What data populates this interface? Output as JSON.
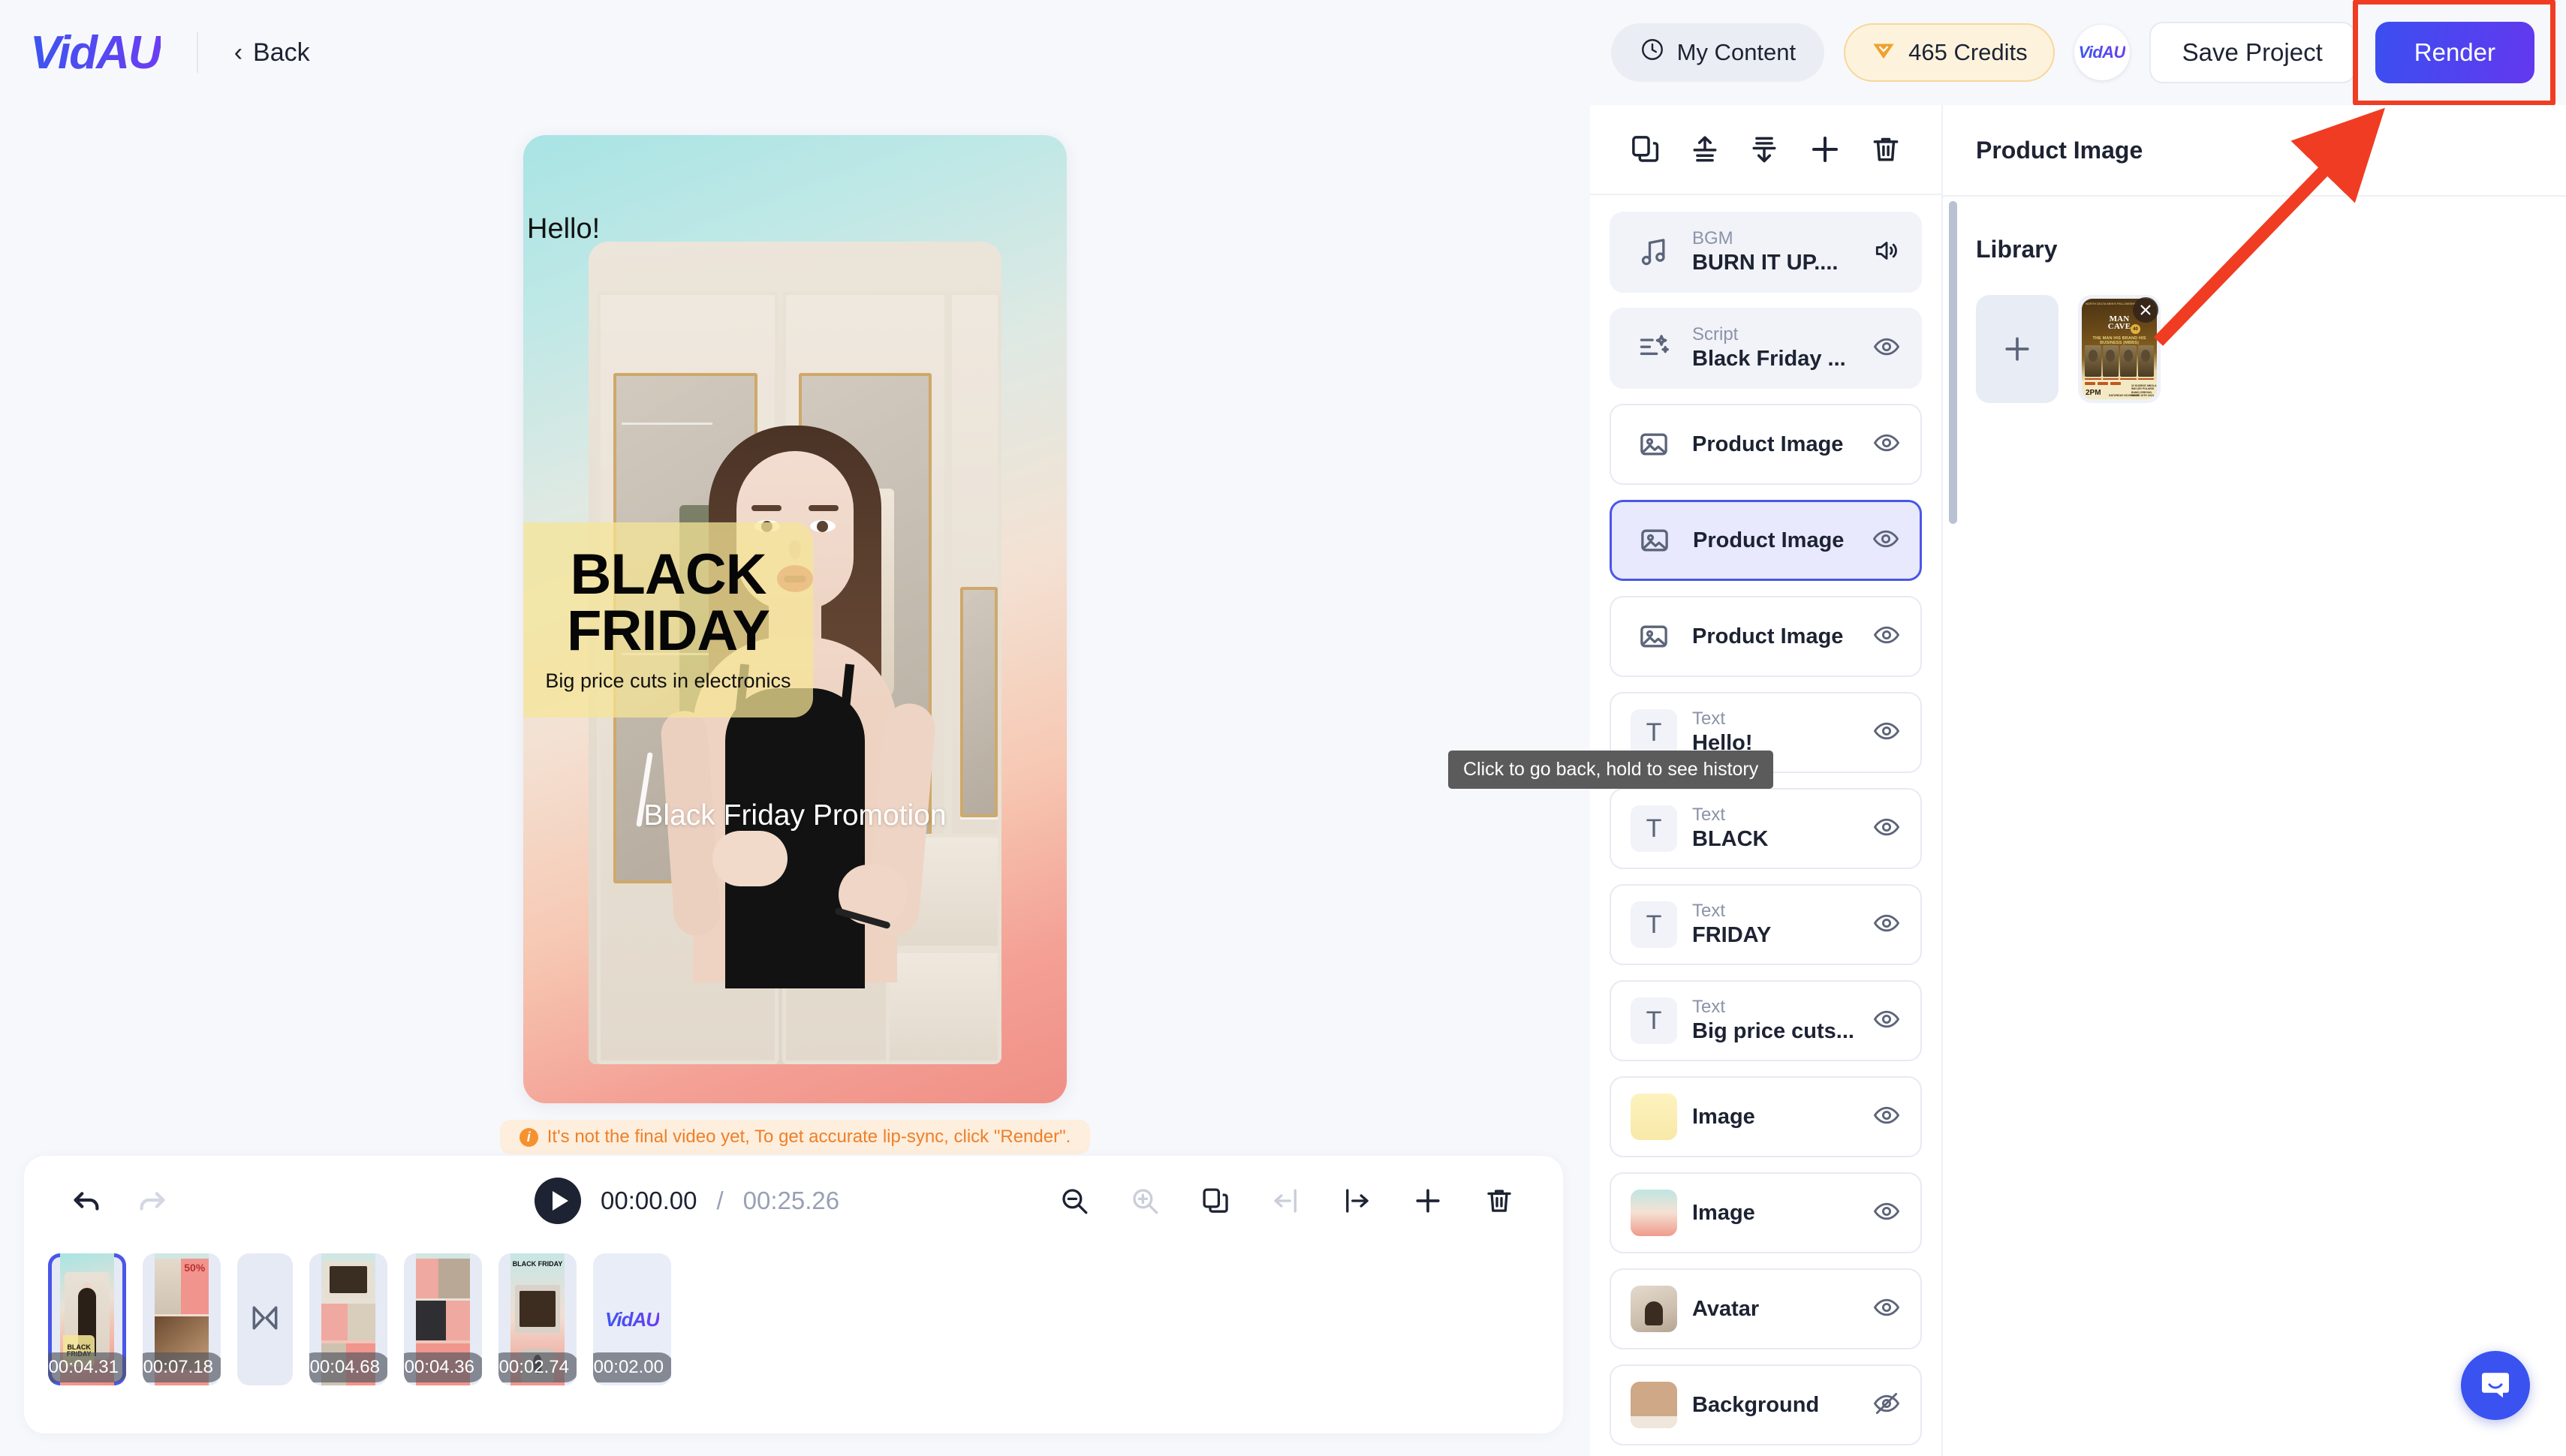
{
  "brand": {
    "logo": "VidAU",
    "accent": "#4a56e8",
    "render_gradient_from": "#3b4ff0",
    "render_gradient_to": "#6338ee"
  },
  "topbar": {
    "back_label": "Back",
    "my_content_label": "My Content",
    "credits_label": "465 Credits",
    "avatar_label": "VidAU",
    "save_label": "Save Project",
    "render_label": "Render"
  },
  "preview": {
    "hello_text": "Hello!",
    "black_text": "BLACK",
    "friday_text": "FRIDAY",
    "subtitle_text": "Big price cuts in electronics",
    "caption_text": "Black Friday Promotion",
    "notice_text": "It's not the final video yet, To get accurate lip-sync, click \"Render\"."
  },
  "timeline": {
    "current_time": "00:00.00",
    "separator": "/",
    "total_time": "00:25.26",
    "clips": [
      {
        "duration": "00:04.31",
        "art": "mc1",
        "selected": true
      },
      {
        "duration": "00:07.18",
        "art": "mc2",
        "selected": false
      },
      {
        "duration": "00:04.68",
        "art": "mc3",
        "selected": false
      },
      {
        "duration": "00:04.36",
        "art": "mc4",
        "selected": false
      },
      {
        "duration": "00:02.74",
        "art": "mc5",
        "selected": false
      },
      {
        "duration": "00:02.00",
        "art": "mc6",
        "selected": false
      }
    ],
    "clip1_black": "BLACK",
    "clip1_friday": "FRIDAY",
    "clip2_pct": "50%",
    "clip5_title": "BLACK FRIDAY",
    "clip6_logo": "VidAU"
  },
  "layers": {
    "toolbar": [
      "duplicate-icon",
      "bring-forward-icon",
      "send-backward-icon",
      "add-icon",
      "delete-icon"
    ],
    "items": [
      {
        "kind": "bgm",
        "sub": "BGM",
        "title": "BURN IT UP....",
        "eye": "volume",
        "shaded": true,
        "selected": false
      },
      {
        "kind": "script",
        "sub": "Script",
        "title": "Black Friday ...",
        "eye": "visible",
        "shaded": true,
        "selected": false
      },
      {
        "kind": "image",
        "sub": "",
        "title": "Product Image",
        "eye": "visible",
        "shaded": false,
        "selected": false
      },
      {
        "kind": "image",
        "sub": "",
        "title": "Product Image",
        "eye": "visible",
        "shaded": false,
        "selected": true
      },
      {
        "kind": "image",
        "sub": "",
        "title": "Product Image",
        "eye": "visible",
        "shaded": false,
        "selected": false
      },
      {
        "kind": "text",
        "sub": "Text",
        "title": "Hello!",
        "eye": "visible",
        "shaded": false,
        "selected": false
      },
      {
        "kind": "text",
        "sub": "Text",
        "title": "BLACK",
        "eye": "visible",
        "shaded": false,
        "selected": false
      },
      {
        "kind": "text",
        "sub": "Text",
        "title": "FRIDAY",
        "eye": "visible",
        "shaded": false,
        "selected": false
      },
      {
        "kind": "text",
        "sub": "Text",
        "title": "Big price cuts...",
        "eye": "visible",
        "shaded": false,
        "selected": false
      },
      {
        "kind": "yellow",
        "sub": "",
        "title": "Image",
        "eye": "visible",
        "shaded": false,
        "selected": false
      },
      {
        "kind": "grad",
        "sub": "",
        "title": "Image",
        "eye": "visible",
        "shaded": false,
        "selected": false
      },
      {
        "kind": "avatar",
        "sub": "",
        "title": "Avatar",
        "eye": "visible",
        "shaded": false,
        "selected": false
      },
      {
        "kind": "bg",
        "sub": "",
        "title": "Background",
        "eye": "hidden",
        "shaded": false,
        "selected": false
      }
    ]
  },
  "library": {
    "header": "Product Image",
    "title": "Library",
    "add_label": "+",
    "poster": {
      "org": "NORTH DELTA\nMEN'S FELLOWSHIP",
      "title_line1": "MAN",
      "title_line2": "CAVE",
      "badge": "40",
      "subtitle": "THE MAN  HIS BRAND  HIS BUSINESS (MBBS)",
      "time": "2PM",
      "date": "SATURDAY\nNOVEMBER 16TH\n2024",
      "location": "32 KUDIRAT ABIOLA\nWAY (BY POLARIS\nBANK) OREGUN, IKEJA"
    }
  },
  "tooltip": {
    "text": "Click to go back, hold to see history"
  },
  "annotations": {
    "highlight_color": "#f03c22",
    "arrow_color": "#f03c22"
  }
}
